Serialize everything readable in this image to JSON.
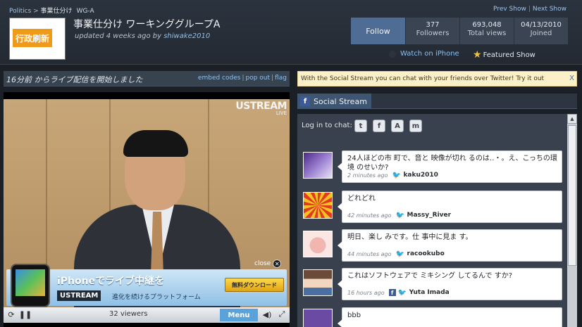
{
  "header": {
    "breadcrumb": {
      "category": "Politics",
      "separator": " > ",
      "current": "事業仕分け",
      "tag": "WG-A"
    },
    "nav": {
      "prev": "Prev Show",
      "separator": "|",
      "next": "Next Show"
    },
    "logo_text": "行政刷新",
    "title": "事業仕分け ワーキンググループA",
    "updated_prefix": "updated 4 weeks ago by",
    "updated_user": "shiwake2010",
    "follow_label": "Follow",
    "stats": [
      {
        "value": "377",
        "label": "Followers"
      },
      {
        "value": "693,048",
        "label": "Total views"
      },
      {
        "value": "04/13/2010",
        "label": "Joined"
      }
    ],
    "iphone_link": "Watch on iPhone",
    "featured": "Featured Show"
  },
  "status": {
    "text": "16分前 からライブ配信を開始しました",
    "links": [
      "embed codes",
      "pop out",
      "flag"
    ],
    "separator": "|"
  },
  "player": {
    "watermark_brand": "USTREAM",
    "watermark_live": "LIVE",
    "close_label": "close",
    "ad": {
      "title": "iPhoneでライブ中継を",
      "brand": "USTREAM",
      "subtitle": "進化を続けるプラットフォーム",
      "button": "無料ダウンロード"
    },
    "viewers": "32 viewers",
    "menu": "Menu"
  },
  "promo": {
    "text": "With the Social Stream you can chat with your friends over Twitter! Try it out",
    "close": "X"
  },
  "social_stream": {
    "title": "Social Stream",
    "login_label": "Log in to chat:",
    "posts": [
      {
        "message": "24人ほどの市 町で、音と 映像が切れ るのは‥・。え、こっちの環境 のせいか?",
        "time": "2 minutes ago",
        "author": "kaku2010",
        "via": "twitter"
      },
      {
        "message": "どれどれ",
        "time": "42 minutes ago",
        "author": "Massy_River",
        "via": "twitter"
      },
      {
        "message": "明日、楽し みです。仕 事中に見ま す。",
        "time": "44 minutes ago",
        "author": "racookubo",
        "via": "twitter"
      },
      {
        "message": "これはソフトウェアで ミキシング してるんで すか?",
        "time": "16 hours ago",
        "author": "Yuta Imada",
        "via": "facebook+twitter"
      },
      {
        "message": "bbb",
        "time": "",
        "author": "",
        "via": "twitter"
      }
    ]
  },
  "colors": {
    "background": "#1b1f26",
    "link": "#8fc0ee",
    "follow_button": "#4f6d94",
    "promo_bg": "#fbf0c8",
    "menu_button": "#5aa2da",
    "logo_orange": "#f09a1a"
  }
}
